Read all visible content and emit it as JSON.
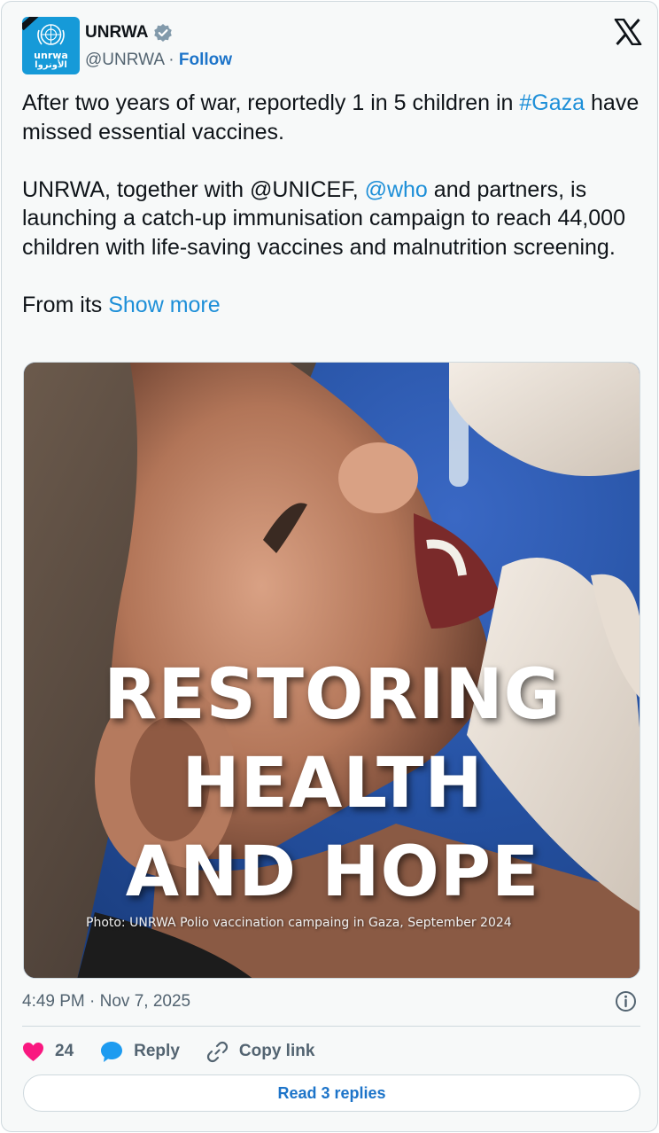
{
  "account": {
    "name": "UNRWA",
    "handle": "@UNRWA",
    "separator": "·",
    "follow_label": "Follow",
    "avatar_text_en": "unrwa",
    "avatar_text_ar": "الأونروا",
    "verified_icon": "verified-badge-icon",
    "platform_icon": "x-logo-icon"
  },
  "tweet": {
    "para1_a": "After two years of war, reportedly 1 in 5 children in ",
    "para1_hashtag": "#Gaza",
    "para1_b": " have missed essential vaccines.",
    "para2_a": "UNRWA, together with @UNICEF, ",
    "para2_mention": "@who",
    "para2_b": " and partners, is launching a catch-up immunisation campaign to reach 44,000 children with life-saving vaccines and malnutrition screening.",
    "para3_a": "From its ",
    "show_more_label": "Show more"
  },
  "media": {
    "headline_line1": "RESTORING",
    "headline_line2": "HEALTH",
    "headline_line3": "AND HOPE",
    "caption": "Photo: UNRWA Polio vaccination campaing in Gaza, September 2024"
  },
  "meta": {
    "timestamp": "4:49 PM · Nov 7, 2025",
    "info_icon": "info-icon"
  },
  "actions": {
    "like_count": "24",
    "reply_label": "Reply",
    "copy_link_label": "Copy link",
    "read_replies_label": "Read 3 replies"
  },
  "colors": {
    "link": "#1d8fd8",
    "follow": "#1d74c9",
    "heart": "#f91880",
    "reply_bubble": "#1d9bf0",
    "avatar_bg": "#169ad8"
  }
}
